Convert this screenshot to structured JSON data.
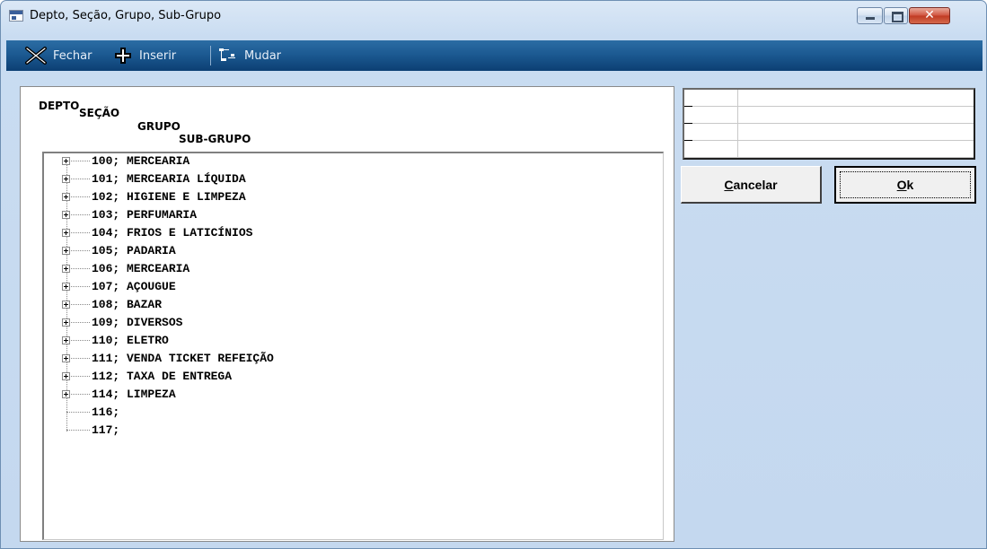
{
  "window": {
    "title": "Depto, Seção, Grupo, Sub-Grupo"
  },
  "toolbar": {
    "fechar_label": "Fechar",
    "inserir_label": "Inserir",
    "mudar_label": "Mudar",
    "icons": {
      "fechar": "close-x-icon",
      "inserir": "plus-icon",
      "mudar": "move-tree-icon"
    }
  },
  "tree_header": {
    "depto": "DEPTO",
    "secao": "SEÇÃO",
    "grupo": "GRUPO",
    "subgrupo": "SUB-GRUPO"
  },
  "tree_items": [
    {
      "label": "100; MERCEARIA",
      "expandable": true
    },
    {
      "label": "101; MERCEARIA LÍQUIDA",
      "expandable": true
    },
    {
      "label": "102; HIGIENE E LIMPEZA",
      "expandable": true
    },
    {
      "label": "103; PERFUMARIA",
      "expandable": true
    },
    {
      "label": "104; FRIOS E LATICÍNIOS",
      "expandable": true
    },
    {
      "label": "105; PADARIA",
      "expandable": true
    },
    {
      "label": "106; MERCEARIA",
      "expandable": true
    },
    {
      "label": "107; AÇOUGUE",
      "expandable": true
    },
    {
      "label": "108; BAZAR",
      "expandable": true
    },
    {
      "label": "109; DIVERSOS",
      "expandable": true
    },
    {
      "label": "110; ELETRO",
      "expandable": true
    },
    {
      "label": "111; VENDA TICKET REFEIÇÃO",
      "expandable": true
    },
    {
      "label": "112; TAXA DE ENTREGA",
      "expandable": true
    },
    {
      "label": "114; LIMPEZA",
      "expandable": true
    },
    {
      "label": "116;",
      "expandable": false
    },
    {
      "label": "117;",
      "expandable": false
    }
  ],
  "buttons": {
    "cancel_accel": "C",
    "cancel_rest": "ancelar",
    "ok_accel": "O",
    "ok_rest": "k"
  },
  "colors": {
    "toolbar_bg": "#1c5a92",
    "toolbar_text": "#e6eef8",
    "window_bg": "#c4d8ef",
    "close_button": "#c4422a"
  }
}
